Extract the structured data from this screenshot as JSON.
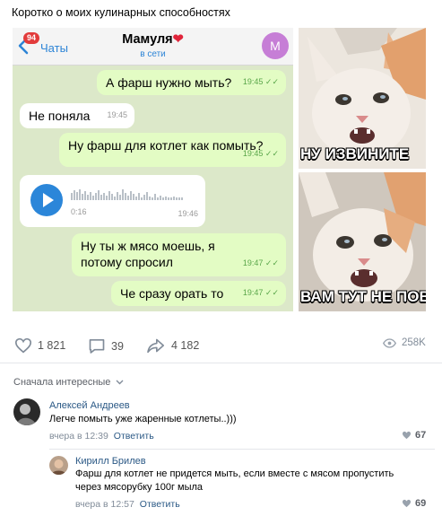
{
  "post": {
    "title": "Коротко о моих кулинарных способностях"
  },
  "chat": {
    "unread_count": "94",
    "back_label": "Чаты",
    "contact_name": "Мамуля",
    "contact_status": "в сети",
    "avatar_letter": "М",
    "messages": [
      {
        "text": "А фарш нужно мыть?",
        "time": "19:45"
      },
      {
        "text": "Не поняла",
        "time": "19:45"
      },
      {
        "text": "Ну фарш для котлет как помыть?",
        "time": "19:45"
      },
      {
        "voice_duration": "0:16",
        "time": "19:46"
      },
      {
        "text": "Ну ты ж мясо моешь, я потому спросил",
        "time": "19:47"
      },
      {
        "text": "Че сразу орать то",
        "time": "19:47"
      }
    ]
  },
  "memes": {
    "top_caption": "НУ ИЗВИНИТЕ",
    "bottom_caption": "ВАМ ТУТ НЕ ПОВ"
  },
  "actions": {
    "likes": "1 821",
    "comments": "39",
    "shares": "4 182",
    "views": "258K"
  },
  "comments": {
    "sort_label": "Сначала интересные",
    "items": [
      {
        "author": "Алексей Андреев",
        "text": "Легче помыть уже жаренные котлеты..)))",
        "date": "вчера в 12:39",
        "reply_label": "Ответить",
        "likes": "67"
      },
      {
        "author": "Кирилл Брилев",
        "text": "Фарш для котлет не придется мыть, если вместе с мясом пропустить через мясорубку 100г мыла",
        "date": "вчера в 12:57",
        "reply_label": "Ответить",
        "likes": "69"
      }
    ]
  },
  "colors": {
    "link": "#2a5885",
    "chat_bg": "#dce8c9",
    "outgoing_bubble": "#e3fcc4",
    "accent_blue": "#2b86d9"
  }
}
